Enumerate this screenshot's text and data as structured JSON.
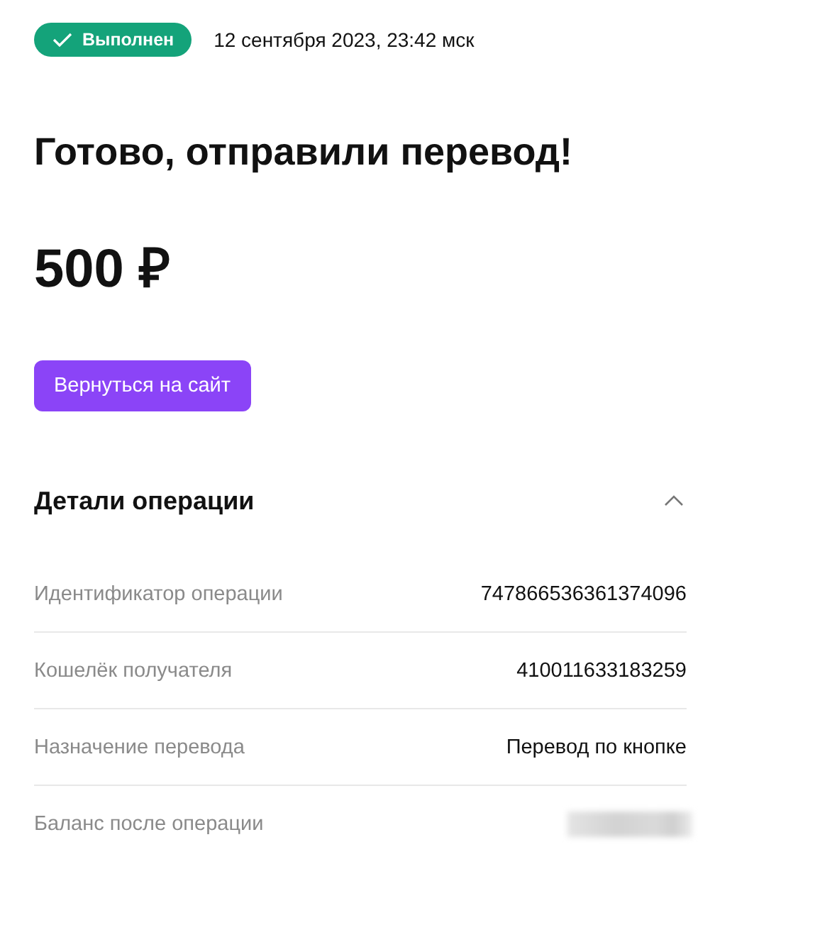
{
  "status": {
    "label": "Выполнен",
    "kind": "success"
  },
  "date": "12 сентября 2023, 23:42 мск",
  "title": "Готово, отправили перевод!",
  "amount": "500 ₽",
  "button": "Вернуться на сайт",
  "details": {
    "title": "Детали операции",
    "expanded": true,
    "rows": [
      {
        "label": "Идентификатор операции",
        "kind": "text",
        "value": "747866536361374096"
      },
      {
        "label": "Кошелёк получателя",
        "kind": "text",
        "value": "410011633183259"
      },
      {
        "label": "Назначение перевода",
        "kind": "text",
        "value": "Перевод по кнопке"
      },
      {
        "label": "Баланс после операции",
        "kind": "blurred"
      }
    ]
  }
}
